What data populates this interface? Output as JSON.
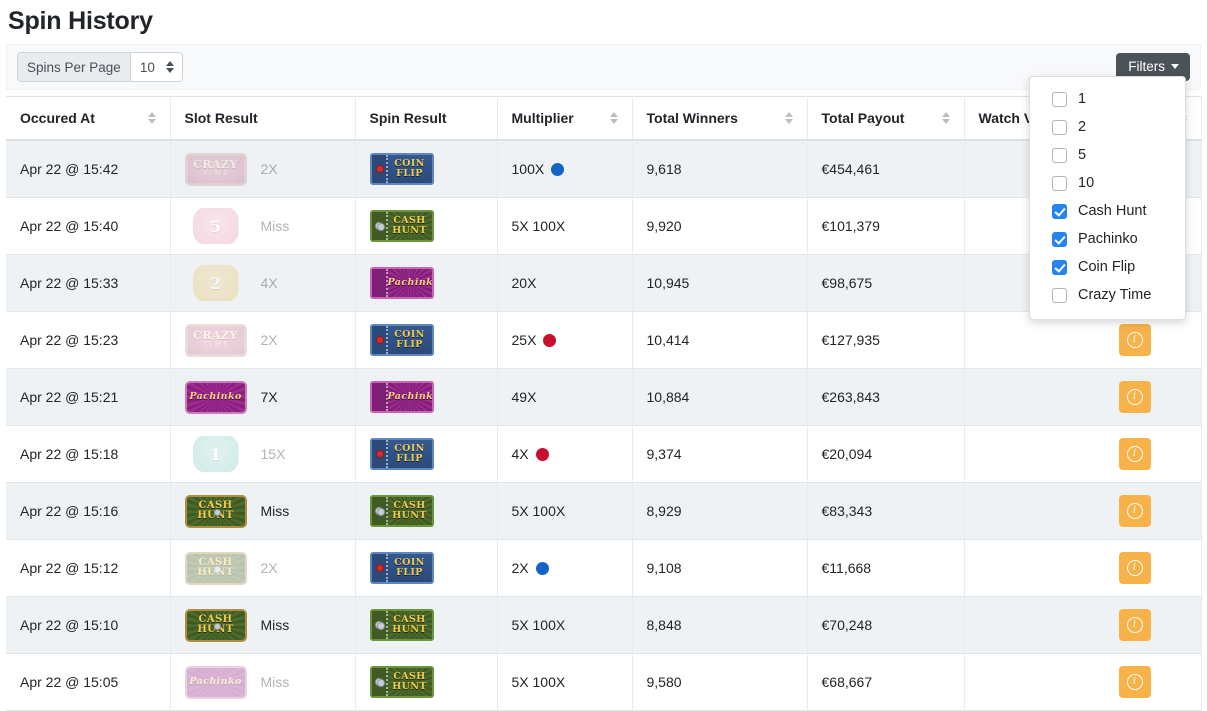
{
  "page": {
    "title": "Spin History"
  },
  "toolbar": {
    "per_page_label": "Spins Per Page",
    "per_page_value": "10",
    "filters_label": "Filters"
  },
  "filters_menu": {
    "items": [
      {
        "label": "1",
        "checked": false
      },
      {
        "label": "2",
        "checked": false
      },
      {
        "label": "5",
        "checked": false
      },
      {
        "label": "10",
        "checked": false
      },
      {
        "label": "Cash Hunt",
        "checked": true
      },
      {
        "label": "Pachinko",
        "checked": true
      },
      {
        "label": "Coin Flip",
        "checked": true
      },
      {
        "label": "Crazy Time",
        "checked": false
      }
    ]
  },
  "table": {
    "columns": [
      {
        "label": "Occured At",
        "sortable": true
      },
      {
        "label": "Slot Result",
        "sortable": false
      },
      {
        "label": "Spin Result",
        "sortable": false
      },
      {
        "label": "Multiplier",
        "sortable": true
      },
      {
        "label": "Total Winners",
        "sortable": true
      },
      {
        "label": "Total Payout",
        "sortable": true
      },
      {
        "label": "Watch Vi",
        "sortable": true
      }
    ],
    "rows": [
      {
        "occured_at": "Apr 22 @ 15:42",
        "slot_kind": "crazytime",
        "slot_caption": "Crazy Time",
        "slot_value": "2X",
        "slot_faded": true,
        "spin_kind": "coinflip",
        "spin_l1": "COIN",
        "spin_l2": "FLIP",
        "multiplier": "100X",
        "mult_dot": "blue",
        "total_winners": "9,618",
        "total_payout": "€454,461",
        "watch": true
      },
      {
        "occured_at": "Apr 22 @ 15:40",
        "slot_kind": "number",
        "slot_caption": "5",
        "slot_color": "pink",
        "slot_value": "Miss",
        "slot_faded": true,
        "spin_kind": "cashhunt",
        "spin_l1": "CASH",
        "spin_l2": "HUNT",
        "multiplier": "5X 100X",
        "mult_dot": "",
        "total_winners": "9,920",
        "total_payout": "€101,379",
        "watch": true
      },
      {
        "occured_at": "Apr 22 @ 15:33",
        "slot_kind": "number",
        "slot_caption": "2",
        "slot_color": "gold",
        "slot_value": "4X",
        "slot_faded": true,
        "spin_kind": "pachinko",
        "spin_l1": "Pachinko",
        "spin_l2": "",
        "multiplier": "20X",
        "mult_dot": "",
        "total_winners": "10,945",
        "total_payout": "€98,675",
        "watch": true
      },
      {
        "occured_at": "Apr 22 @ 15:23",
        "slot_kind": "crazytime",
        "slot_caption": "Crazy Time",
        "slot_value": "2X",
        "slot_faded": true,
        "spin_kind": "coinflip",
        "spin_l1": "COIN",
        "spin_l2": "FLIP",
        "multiplier": "25X",
        "mult_dot": "red",
        "total_winners": "10,414",
        "total_payout": "€127,935",
        "watch": true
      },
      {
        "occured_at": "Apr 22 @ 15:21",
        "slot_kind": "pachinko",
        "slot_caption": "Pachinko",
        "slot_value": "7X",
        "slot_faded": false,
        "spin_kind": "pachinko",
        "spin_l1": "Pachinko",
        "spin_l2": "",
        "multiplier": "49X",
        "mult_dot": "",
        "total_winners": "10,884",
        "total_payout": "€263,843",
        "watch": true
      },
      {
        "occured_at": "Apr 22 @ 15:18",
        "slot_kind": "number",
        "slot_caption": "1",
        "slot_color": "teal",
        "slot_value": "15X",
        "slot_faded": true,
        "spin_kind": "coinflip",
        "spin_l1": "COIN",
        "spin_l2": "FLIP",
        "multiplier": "4X",
        "mult_dot": "red",
        "total_winners": "9,374",
        "total_payout": "€20,094",
        "watch": true
      },
      {
        "occured_at": "Apr 22 @ 15:16",
        "slot_kind": "cashhunt",
        "slot_caption": "Cash Hunt",
        "slot_value": "Miss",
        "slot_faded": false,
        "spin_kind": "cashhunt",
        "spin_l1": "CASH",
        "spin_l2": "HUNT",
        "multiplier": "5X 100X",
        "mult_dot": "",
        "total_winners": "8,929",
        "total_payout": "€83,343",
        "watch": true
      },
      {
        "occured_at": "Apr 22 @ 15:12",
        "slot_kind": "cashhunt",
        "slot_caption": "Cash Hunt",
        "slot_value": "2X",
        "slot_faded": true,
        "spin_kind": "coinflip",
        "spin_l1": "COIN",
        "spin_l2": "FLIP",
        "multiplier": "2X",
        "mult_dot": "blue",
        "total_winners": "9,108",
        "total_payout": "€11,668",
        "watch": true
      },
      {
        "occured_at": "Apr 22 @ 15:10",
        "slot_kind": "cashhunt",
        "slot_caption": "Cash Hunt",
        "slot_value": "Miss",
        "slot_faded": false,
        "spin_kind": "cashhunt",
        "spin_l1": "CASH",
        "spin_l2": "HUNT",
        "multiplier": "5X 100X",
        "mult_dot": "",
        "total_winners": "8,848",
        "total_payout": "€70,248",
        "watch": true
      },
      {
        "occured_at": "Apr 22 @ 15:05",
        "slot_kind": "pachinko",
        "slot_caption": "Pachinko",
        "slot_value": "Miss",
        "slot_faded": true,
        "spin_kind": "cashhunt",
        "spin_l1": "CASH",
        "spin_l2": "HUNT",
        "multiplier": "5X 100X",
        "mult_dot": "",
        "total_winners": "9,580",
        "total_payout": "€68,667",
        "watch": true
      }
    ]
  },
  "colors": {
    "filters_button": "#4b5258",
    "checkbox_checked": "#2684f0",
    "info_button": "#f7b24a",
    "dot_blue": "#1464c8",
    "dot_red": "#c8102e",
    "row_shade": "#eff2f5"
  }
}
